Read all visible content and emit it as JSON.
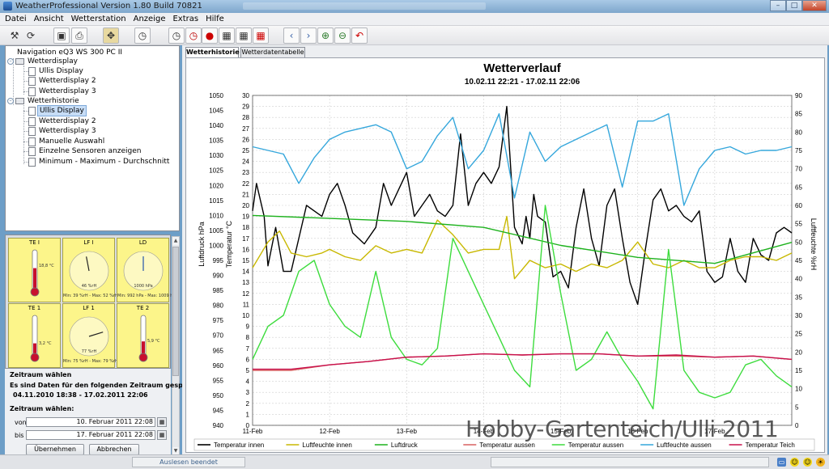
{
  "window": {
    "title": "WeatherProfessional   Version 1.80  Build 70821",
    "app_icon": "app-icon"
  },
  "menu": [
    "Datei",
    "Ansicht",
    "Wetterstation",
    "Anzeige",
    "Extras",
    "Hilfe"
  ],
  "toolbar": {
    "buttons": [
      "wizard-icon",
      "refresh-icon",
      "save-icon",
      "print-icon",
      "move-icon",
      "clock-icon",
      "history-icon",
      "history-red-icon",
      "record-icon",
      "calendar-week-icon",
      "calendar-icon",
      "calendar-red-icon",
      "prev-icon",
      "next-icon",
      "zoom-in-icon",
      "zoom-out-icon",
      "undo-icon"
    ]
  },
  "navigation": {
    "root": "Navigation eQ3 WS 300 PC II",
    "groups": [
      {
        "label": "Wetterdisplay",
        "items": [
          "Ullis Display",
          "Wetterdisplay 2",
          "Wetterdisplay 3"
        ]
      },
      {
        "label": "Wetterhistorie",
        "items": [
          "Ullis Display",
          "Wetterdisplay 2",
          "Wetterdisplay 3",
          "Manuelle Auswahl",
          "Einzelne Sensoren anzeigen",
          "Minimum - Maximum - Durchschnitt"
        ]
      }
    ],
    "selected": "Wetterhistorie / Ullis Display"
  },
  "gauges": [
    {
      "title": "TE I",
      "kind": "thermometer",
      "reading": "18,8 °C",
      "fill": 0.55
    },
    {
      "title": "LF I",
      "kind": "dial",
      "reading": "46 %rH",
      "footer": "Min: 39 %rH - Max: 52 %rH",
      "level": 0.46
    },
    {
      "title": "LD",
      "kind": "dial",
      "reading": "1000 hPa",
      "footer": "Min: 992 hPa - Max: 1009 hPa",
      "level": 0.5
    },
    {
      "title": "TE 1",
      "kind": "thermometer",
      "reading": "3,2 °C",
      "fill": 0.3
    },
    {
      "title": "LF 1",
      "kind": "dial",
      "reading": "77 %rH",
      "footer": "Min: 75 %rH - Max: 79 %rH",
      "level": 0.77
    },
    {
      "title": "TE 2",
      "kind": "thermometer",
      "reading": "5,9 °C",
      "fill": 0.35
    }
  ],
  "zeitraum": {
    "heading": "Zeitraum wählen",
    "info": "Es sind Daten für den folgenden Zeitraum gespeichert:",
    "range": "04.11.2010 18:38 - 17.02.2011 22:06",
    "select_label": "Zeitraum wählen:",
    "from_label": "von",
    "from_value": "10. Februar 2011 22:08",
    "to_label": "bis",
    "to_value": "17. Februar 2011 22:08",
    "apply_button": "Übernehmen",
    "cancel_button": "Abbrechen"
  },
  "tabs": [
    "Wetterhistorie",
    "Wetterdatentabelle"
  ],
  "active_tab": "Wetterhistorie",
  "chart_data": {
    "type": "line",
    "title": "Wetterverlauf",
    "subtitle": "10.02.11 22:21 - 17.02.11 22:06",
    "x_ticks": [
      "11-Feb",
      "12-Feb",
      "13-Feb",
      "14-Feb",
      "15-Feb",
      "16-Feb",
      "17-Feb"
    ],
    "x_range": [
      0,
      7
    ],
    "axes": {
      "pressure": {
        "label": "Luftdruck  hPa",
        "range": [
          940,
          1050
        ],
        "step": 5
      },
      "temperature": {
        "label": "Temperatur  °C",
        "range": [
          0,
          30
        ],
        "step": 1
      },
      "humidity": {
        "label": "Luftfeuchte  %rH",
        "range": [
          0,
          90
        ],
        "step": 5
      }
    },
    "series": [
      {
        "name": "Temperatur innen",
        "axis": "temperature",
        "color": "#000000",
        "x": [
          0,
          0.05,
          0.15,
          0.2,
          0.3,
          0.4,
          0.5,
          0.7,
          0.9,
          1.0,
          1.1,
          1.2,
          1.3,
          1.45,
          1.6,
          1.7,
          1.8,
          1.9,
          2.0,
          2.1,
          2.2,
          2.3,
          2.4,
          2.5,
          2.6,
          2.7,
          2.8,
          2.9,
          3.0,
          3.1,
          3.2,
          3.3,
          3.4,
          3.5,
          3.55,
          3.6,
          3.65,
          3.7,
          3.8,
          3.9,
          4.0,
          4.1,
          4.2,
          4.3,
          4.4,
          4.5,
          4.6,
          4.7,
          4.8,
          4.9,
          5.0,
          5.1,
          5.2,
          5.3,
          5.4,
          5.5,
          5.6,
          5.7,
          5.8,
          5.9,
          6.0,
          6.1,
          6.2,
          6.3,
          6.4,
          6.5,
          6.6,
          6.7,
          6.8,
          6.9,
          7.0
        ],
        "y": [
          19.5,
          22,
          19,
          14.5,
          18,
          14,
          14,
          20,
          19,
          21,
          22,
          20,
          17.5,
          16.5,
          18,
          22,
          20,
          21.5,
          23,
          19,
          20,
          21,
          19.5,
          19,
          20,
          26.5,
          20,
          22,
          23,
          22,
          23.5,
          29,
          18,
          16.5,
          19,
          17,
          21,
          19,
          18.5,
          13.5,
          14,
          12.5,
          18,
          21.5,
          17,
          14.5,
          20,
          21.5,
          17,
          13,
          11,
          16,
          20.5,
          21.5,
          19.5,
          20,
          19,
          18.5,
          19.5,
          14,
          13,
          13.5,
          17,
          14,
          13,
          17,
          15.5,
          15,
          17.5,
          18,
          17.5
        ]
      },
      {
        "name": "Luftfeuchte innen",
        "axis": "humidity",
        "color": "#c8b800",
        "x": [
          0,
          0.2,
          0.35,
          0.5,
          0.7,
          0.9,
          1.0,
          1.2,
          1.4,
          1.6,
          1.8,
          2.0,
          2.2,
          2.4,
          2.6,
          2.8,
          3.0,
          3.2,
          3.3,
          3.4,
          3.6,
          3.8,
          4.0,
          4.2,
          4.4,
          4.6,
          4.8,
          5.0,
          5.2,
          5.4,
          5.6,
          5.8,
          6.0,
          6.2,
          6.4,
          6.6,
          6.8,
          7.0
        ],
        "y": [
          43,
          50,
          53,
          47,
          46,
          47,
          48,
          46,
          45,
          49,
          47,
          48,
          47,
          56,
          52,
          47,
          48,
          48,
          57,
          40,
          45,
          43,
          44,
          42,
          44,
          43,
          45,
          50,
          44,
          43,
          45,
          43,
          43,
          45,
          46,
          46,
          45,
          47
        ]
      },
      {
        "name": "Luftdruck",
        "axis": "pressure",
        "color": "#1db21d",
        "x": [
          0,
          1,
          2,
          3,
          3.5,
          4,
          5,
          6,
          7
        ],
        "y": [
          1010,
          1009,
          1008,
          1006,
          1003,
          1000,
          996,
          994,
          1001
        ]
      },
      {
        "name": "Temperatur aussen",
        "axis": "temperature",
        "color": "#d86060",
        "x": [
          0,
          0.5,
          1,
          1.5,
          2,
          2.5,
          3,
          3.5,
          4,
          4.5,
          5,
          5.5,
          6,
          6.5,
          7
        ],
        "y": [
          5,
          5,
          5.5,
          5.8,
          6.2,
          6.3,
          6.5,
          6.4,
          6.5,
          6.5,
          6.3,
          6.3,
          6.2,
          6.3,
          6
        ]
      },
      {
        "name": "Temperatur aussen",
        "axis": "temperature",
        "color": "#3ddc3d",
        "x": [
          0,
          0.2,
          0.4,
          0.6,
          0.8,
          1.0,
          1.2,
          1.4,
          1.6,
          1.8,
          2.0,
          2.2,
          2.4,
          2.6,
          2.8,
          3.0,
          3.2,
          3.4,
          3.6,
          3.8,
          4.0,
          4.2,
          4.4,
          4.6,
          4.8,
          5.0,
          5.2,
          5.4,
          5.6,
          5.8,
          6.0,
          6.2,
          6.4,
          6.6,
          6.8,
          7.0
        ],
        "y": [
          6,
          9,
          10,
          14,
          15,
          11,
          9,
          8,
          14,
          8,
          6,
          5.5,
          7,
          17,
          14,
          11,
          8,
          5,
          3.5,
          20,
          12,
          5,
          6,
          8.5,
          6,
          4,
          1.5,
          16,
          5,
          3,
          2.5,
          3,
          5.5,
          6,
          4.5,
          3.5
        ]
      },
      {
        "name": "Luftfeuchte aussen",
        "axis": "humidity",
        "color": "#35a7dc",
        "x": [
          0,
          0.2,
          0.4,
          0.6,
          0.8,
          1.0,
          1.2,
          1.4,
          1.6,
          1.8,
          2.0,
          2.2,
          2.4,
          2.6,
          2.8,
          3.0,
          3.2,
          3.4,
          3.6,
          3.8,
          4.0,
          4.2,
          4.4,
          4.6,
          4.8,
          5.0,
          5.2,
          5.4,
          5.6,
          5.8,
          6.0,
          6.2,
          6.4,
          6.6,
          6.8,
          7.0
        ],
        "y": [
          76,
          75,
          74,
          66,
          73,
          78,
          80,
          81,
          82,
          80,
          70,
          72,
          79,
          84,
          70,
          75,
          85,
          62,
          80,
          72,
          76,
          78,
          80,
          82,
          65,
          83,
          83,
          85,
          60,
          70,
          75,
          76,
          74,
          75,
          75,
          76
        ]
      },
      {
        "name": "Temperatur Teich",
        "axis": "temperature",
        "color": "#c8104c",
        "x": [
          0,
          0.5,
          1,
          1.5,
          2,
          2.5,
          3,
          3.5,
          4,
          4.5,
          5,
          5.5,
          6,
          6.5,
          7
        ],
        "y": [
          5.1,
          5.1,
          5.5,
          5.8,
          6.2,
          6.3,
          6.5,
          6.4,
          6.5,
          6.5,
          6.3,
          6.4,
          6.2,
          6.3,
          6.0
        ]
      }
    ],
    "legend": [
      "Temperatur innen",
      "Luftfeuchte innen",
      "Luftdruck",
      "Temperatur aussen",
      "Temperatur aussen",
      "Luftfeuchte aussen",
      "Temperatur Teich"
    ],
    "legend_position": "bottom",
    "grid": true
  },
  "watermark": "Hobby-Gartenteich/Ulli 2011",
  "status": {
    "message": "Auslesen beendet",
    "icons": [
      "monitor-icon",
      "smiley-icon",
      "smiley-icon",
      "sun-icon"
    ]
  }
}
